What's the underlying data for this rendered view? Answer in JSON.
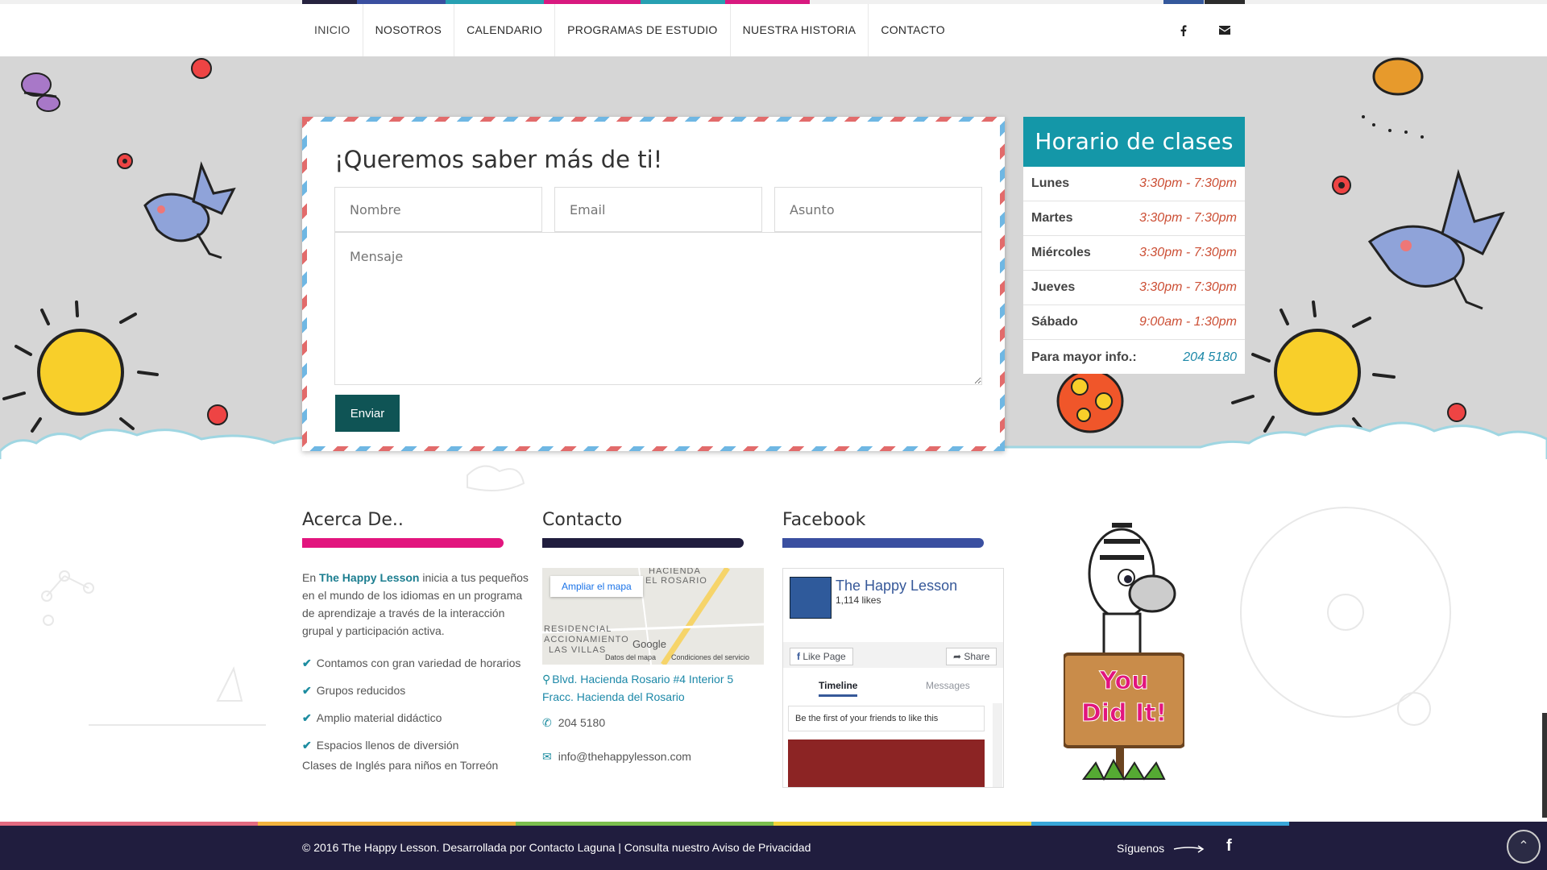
{
  "nav": {
    "items": [
      "INICIO",
      "NOSOTROS",
      "CALENDARIO",
      "PROGRAMAS DE ESTUDIO",
      "NUESTRA HISTORIA",
      "CONTACTO"
    ],
    "social_icons": [
      "facebook-icon",
      "envelope-icon"
    ]
  },
  "form": {
    "title": "¡Queremos saber más de ti!",
    "name_placeholder": "Nombre",
    "email_placeholder": "Email",
    "subject_placeholder": "Asunto",
    "message_placeholder": "Mensaje",
    "submit_label": "Enviar"
  },
  "schedule": {
    "title": "Horario de clases",
    "rows": [
      {
        "day": "Lunes",
        "time": "3:30pm - 7:30pm"
      },
      {
        "day": "Martes",
        "time": "3:30pm - 7:30pm"
      },
      {
        "day": "Miércoles",
        "time": "3:30pm - 7:30pm"
      },
      {
        "day": "Jueves",
        "time": "3:30pm - 7:30pm"
      },
      {
        "day": "Sábado",
        "time": "9:00am - 1:30pm"
      }
    ],
    "info_label": "Para mayor info.:",
    "info_phone": "204 5180"
  },
  "about": {
    "title": "Acerca De..",
    "intro_prefix": "En ",
    "brand": "The Happy Lesson",
    "intro_rest": " inicia a tus pequeños en el mundo de los idiomas en un programa de aprendizaje a través de la interacción grupal y participación activa.",
    "points": [
      "Contamos con gran variedad de horarios",
      "Grupos reducidos",
      "Amplio material didáctico",
      "Espacios llenos de diversión"
    ],
    "footer_line": "Clases de Inglés para niños en Torreón"
  },
  "contact": {
    "title": "Contacto",
    "map_button": "Ampliar el mapa",
    "map_labels": [
      "HACIENDA",
      "EL ROSARIO",
      "RESIDENCIAL",
      "ACCIONAMIENTO",
      "LAS VILLAS",
      "Google",
      "Datos del mapa",
      "Condiciones del servicio"
    ],
    "address_line1": "Blvd. Hacienda Rosario #4 Interior 5",
    "address_line2": "Fracc. Hacienda del Rosario",
    "phone": "204 5180",
    "email": "info@thehappylesson.com"
  },
  "facebook": {
    "title": "Facebook",
    "page_name": "The Happy Lesson",
    "likes": "1,114 likes",
    "like_button": "Like Page",
    "share_button": "Share",
    "tab_timeline": "Timeline",
    "tab_messages": "Messages",
    "first_friend": "Be the first of your friends to like this"
  },
  "zebra_sign": {
    "line1": "You",
    "line2": "Did It!"
  },
  "bottom": {
    "copyright": "© 2016 The Happy Lesson. Desarrollada por Contacto Laguna | Consulta nuestro Aviso de Privacidad",
    "follow": "Síguenos"
  },
  "colors": {
    "teal": "#1497a8",
    "button": "#0f5455",
    "navy": "#201d3e",
    "pink": "#e2157e",
    "fb_blue": "#365899",
    "time": "#cc4f35"
  }
}
